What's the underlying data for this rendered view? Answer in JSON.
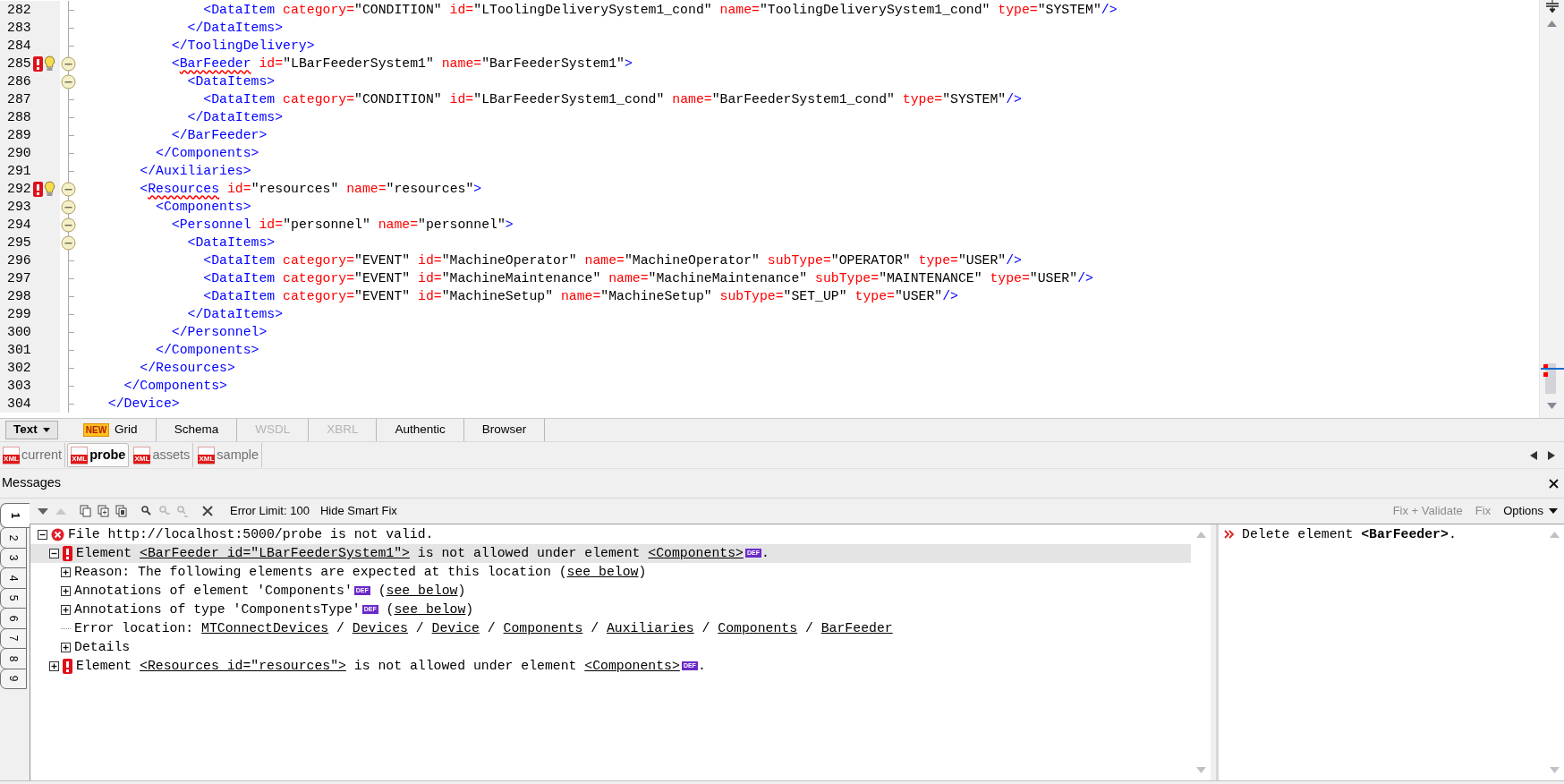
{
  "editor": {
    "lines": [
      {
        "number": "282",
        "error": false,
        "foldable": false,
        "tokens": [
          {
            "kind": "tag",
            "text": "              <DataItem"
          },
          {
            "kind": "attr",
            "text": " category="
          },
          {
            "kind": "value",
            "text": "\"CONDITION\""
          },
          {
            "kind": "attr",
            "text": " id="
          },
          {
            "kind": "value",
            "text": "\"LToolingDeliverySystem1_cond\""
          },
          {
            "kind": "attr",
            "text": " name="
          },
          {
            "kind": "value",
            "text": "\"ToolingDeliverySystem1_cond\""
          },
          {
            "kind": "attr",
            "text": " type="
          },
          {
            "kind": "value",
            "text": "\"SYSTEM\""
          },
          {
            "kind": "tag",
            "text": "/>"
          }
        ]
      },
      {
        "number": "283",
        "error": false,
        "foldable": false,
        "tokens": [
          {
            "kind": "tag",
            "text": "            </DataItems>"
          }
        ]
      },
      {
        "number": "284",
        "error": false,
        "foldable": false,
        "tokens": [
          {
            "kind": "tag",
            "text": "          </ToolingDelivery>"
          }
        ]
      },
      {
        "number": "285",
        "error": true,
        "foldable": true,
        "tokens": [
          {
            "kind": "tag",
            "text": "          <"
          },
          {
            "kind": "tag-error",
            "text": "BarFeeder"
          },
          {
            "kind": "attr",
            "text": " id="
          },
          {
            "kind": "value",
            "text": "\"LBarFeederSystem1\""
          },
          {
            "kind": "attr",
            "text": " name="
          },
          {
            "kind": "value",
            "text": "\"BarFeederSystem1\""
          },
          {
            "kind": "tag",
            "text": ">"
          }
        ]
      },
      {
        "number": "286",
        "error": false,
        "foldable": true,
        "tokens": [
          {
            "kind": "tag",
            "text": "            <DataItems>"
          }
        ]
      },
      {
        "number": "287",
        "error": false,
        "foldable": false,
        "tokens": [
          {
            "kind": "tag",
            "text": "              <DataItem"
          },
          {
            "kind": "attr",
            "text": " category="
          },
          {
            "kind": "value",
            "text": "\"CONDITION\""
          },
          {
            "kind": "attr",
            "text": " id="
          },
          {
            "kind": "value",
            "text": "\"LBarFeederSystem1_cond\""
          },
          {
            "kind": "attr",
            "text": " name="
          },
          {
            "kind": "value",
            "text": "\"BarFeederSystem1_cond\""
          },
          {
            "kind": "attr",
            "text": " type="
          },
          {
            "kind": "value",
            "text": "\"SYSTEM\""
          },
          {
            "kind": "tag",
            "text": "/>"
          }
        ]
      },
      {
        "number": "288",
        "error": false,
        "foldable": false,
        "tokens": [
          {
            "kind": "tag",
            "text": "            </DataItems>"
          }
        ]
      },
      {
        "number": "289",
        "error": false,
        "foldable": false,
        "tokens": [
          {
            "kind": "tag",
            "text": "          </BarFeeder>"
          }
        ]
      },
      {
        "number": "290",
        "error": false,
        "foldable": false,
        "tokens": [
          {
            "kind": "tag",
            "text": "        </Components>"
          }
        ]
      },
      {
        "number": "291",
        "error": false,
        "foldable": false,
        "tokens": [
          {
            "kind": "tag",
            "text": "      </Auxiliaries>"
          }
        ]
      },
      {
        "number": "292",
        "error": true,
        "foldable": true,
        "tokens": [
          {
            "kind": "tag",
            "text": "      <"
          },
          {
            "kind": "tag-error",
            "text": "Resources"
          },
          {
            "kind": "attr",
            "text": " id="
          },
          {
            "kind": "value",
            "text": "\"resources\""
          },
          {
            "kind": "attr",
            "text": " name="
          },
          {
            "kind": "value",
            "text": "\"resources\""
          },
          {
            "kind": "tag",
            "text": ">"
          }
        ]
      },
      {
        "number": "293",
        "error": false,
        "foldable": true,
        "tokens": [
          {
            "kind": "tag",
            "text": "        <Components>"
          }
        ]
      },
      {
        "number": "294",
        "error": false,
        "foldable": true,
        "tokens": [
          {
            "kind": "tag",
            "text": "          <Personnel"
          },
          {
            "kind": "attr",
            "text": " id="
          },
          {
            "kind": "value",
            "text": "\"personnel\""
          },
          {
            "kind": "attr",
            "text": " name="
          },
          {
            "kind": "value",
            "text": "\"personnel\""
          },
          {
            "kind": "tag",
            "text": ">"
          }
        ]
      },
      {
        "number": "295",
        "error": false,
        "foldable": true,
        "tokens": [
          {
            "kind": "tag",
            "text": "            <DataItems>"
          }
        ]
      },
      {
        "number": "296",
        "error": false,
        "foldable": false,
        "tokens": [
          {
            "kind": "tag",
            "text": "              <DataItem"
          },
          {
            "kind": "attr",
            "text": " category="
          },
          {
            "kind": "value",
            "text": "\"EVENT\""
          },
          {
            "kind": "attr",
            "text": " id="
          },
          {
            "kind": "value",
            "text": "\"MachineOperator\""
          },
          {
            "kind": "attr",
            "text": " name="
          },
          {
            "kind": "value",
            "text": "\"MachineOperator\""
          },
          {
            "kind": "attr",
            "text": " subType="
          },
          {
            "kind": "value",
            "text": "\"OPERATOR\""
          },
          {
            "kind": "attr",
            "text": " type="
          },
          {
            "kind": "value",
            "text": "\"USER\""
          },
          {
            "kind": "tag",
            "text": "/>"
          }
        ]
      },
      {
        "number": "297",
        "error": false,
        "foldable": false,
        "tokens": [
          {
            "kind": "tag",
            "text": "              <DataItem"
          },
          {
            "kind": "attr",
            "text": " category="
          },
          {
            "kind": "value",
            "text": "\"EVENT\""
          },
          {
            "kind": "attr",
            "text": " id="
          },
          {
            "kind": "value",
            "text": "\"MachineMaintenance\""
          },
          {
            "kind": "attr",
            "text": " name="
          },
          {
            "kind": "value",
            "text": "\"MachineMaintenance\""
          },
          {
            "kind": "attr",
            "text": " subType="
          },
          {
            "kind": "value",
            "text": "\"MAINTENANCE\""
          },
          {
            "kind": "attr",
            "text": " type="
          },
          {
            "kind": "value",
            "text": "\"USER\""
          },
          {
            "kind": "tag",
            "text": "/>"
          }
        ]
      },
      {
        "number": "298",
        "error": false,
        "foldable": false,
        "tokens": [
          {
            "kind": "tag",
            "text": "              <DataItem"
          },
          {
            "kind": "attr",
            "text": " category="
          },
          {
            "kind": "value",
            "text": "\"EVENT\""
          },
          {
            "kind": "attr",
            "text": " id="
          },
          {
            "kind": "value",
            "text": "\"MachineSetup\""
          },
          {
            "kind": "attr",
            "text": " name="
          },
          {
            "kind": "value",
            "text": "\"MachineSetup\""
          },
          {
            "kind": "attr",
            "text": " subType="
          },
          {
            "kind": "value",
            "text": "\"SET_UP\""
          },
          {
            "kind": "attr",
            "text": " type="
          },
          {
            "kind": "value",
            "text": "\"USER\""
          },
          {
            "kind": "tag",
            "text": "/>"
          }
        ]
      },
      {
        "number": "299",
        "error": false,
        "foldable": false,
        "tokens": [
          {
            "kind": "tag",
            "text": "            </DataItems>"
          }
        ]
      },
      {
        "number": "300",
        "error": false,
        "foldable": false,
        "tokens": [
          {
            "kind": "tag",
            "text": "          </Personnel>"
          }
        ]
      },
      {
        "number": "301",
        "error": false,
        "foldable": false,
        "tokens": [
          {
            "kind": "tag",
            "text": "        </Components>"
          }
        ]
      },
      {
        "number": "302",
        "error": false,
        "foldable": false,
        "tokens": [
          {
            "kind": "tag",
            "text": "      </Resources>"
          }
        ]
      },
      {
        "number": "303",
        "error": false,
        "foldable": false,
        "tokens": [
          {
            "kind": "tag",
            "text": "    </Components>"
          }
        ]
      },
      {
        "number": "304",
        "error": false,
        "foldable": false,
        "tokens": [
          {
            "kind": "tag",
            "text": "  </Device>"
          }
        ]
      }
    ]
  },
  "view_tabs": [
    {
      "label": "Text",
      "selected": true,
      "disabled": false,
      "dropdown": true
    },
    {
      "label": "Grid",
      "badge": "NEW",
      "selected": false,
      "disabled": false,
      "dropdown": false
    },
    {
      "label": "Schema",
      "selected": false,
      "disabled": false,
      "dropdown": false
    },
    {
      "label": "WSDL",
      "selected": false,
      "disabled": true,
      "dropdown": false
    },
    {
      "label": "XBRL",
      "selected": false,
      "disabled": true,
      "dropdown": false
    },
    {
      "label": "Authentic",
      "selected": false,
      "disabled": false,
      "dropdown": false
    },
    {
      "label": "Browser",
      "selected": false,
      "disabled": false,
      "dropdown": false
    }
  ],
  "file_tabs": [
    {
      "label": "current",
      "icon": "XML",
      "selected": false
    },
    {
      "label": "probe",
      "icon": "XML",
      "selected": true
    },
    {
      "label": "assets",
      "icon": "XML",
      "selected": false
    },
    {
      "label": "sample",
      "icon": "XML",
      "selected": false
    }
  ],
  "messages": {
    "title": "Messages",
    "tabs": [
      {
        "label": "1",
        "selected": true
      },
      {
        "label": "2",
        "selected": false
      },
      {
        "label": "3",
        "selected": false
      },
      {
        "label": "4",
        "selected": false
      },
      {
        "label": "5",
        "selected": false
      },
      {
        "label": "6",
        "selected": false
      },
      {
        "label": "7",
        "selected": false
      },
      {
        "label": "8",
        "selected": false
      },
      {
        "label": "9",
        "selected": false
      }
    ],
    "toolbar_icons": [
      {
        "kind": "next",
        "disabled": false
      },
      {
        "kind": "previous",
        "disabled": true
      },
      {
        "kind": "copy",
        "disabled": false
      },
      {
        "kind": "copy-add",
        "disabled": false
      },
      {
        "kind": "copy-all",
        "disabled": false
      },
      {
        "kind": "find",
        "disabled": false
      },
      {
        "kind": "find-next",
        "disabled": true
      },
      {
        "kind": "find-previous",
        "disabled": true
      },
      {
        "kind": "clear",
        "disabled": false
      }
    ],
    "toolbar_buttons": [
      {
        "label": "Error Limit: 100"
      },
      {
        "label": "Hide Smart Fix"
      }
    ],
    "smart_fix_buttons": [
      {
        "label": "Fix + Validate",
        "disabled": true,
        "dropdown": false
      },
      {
        "label": "Fix",
        "disabled": true,
        "dropdown": false
      },
      {
        "label": "Options",
        "disabled": false,
        "dropdown": true
      }
    ],
    "tree": [
      {
        "kind": "file-error",
        "expanded": true,
        "selected": false,
        "segments": [
          {
            "kind": "plain",
            "text": "File http://localhost:5000/probe is not valid."
          }
        ],
        "children": [
          {
            "kind": "error",
            "expanded": true,
            "selected": true,
            "segments": [
              {
                "kind": "plain",
                "text": "Element "
              },
              {
                "kind": "link",
                "text": "<BarFeeder id=\"LBarFeederSystem1\">"
              },
              {
                "kind": "plain",
                "text": " is not allowed under element "
              },
              {
                "kind": "link",
                "text": "<Components>"
              },
              {
                "kind": "def",
                "text": "DEF"
              },
              {
                "kind": "plain",
                "text": "."
              }
            ],
            "children": [
              {
                "expanded": false,
                "selected": false,
                "segments": [
                  {
                    "kind": "plain",
                    "text": "Reason: The following elements are expected at this location ("
                  },
                  {
                    "kind": "link",
                    "text": "see below"
                  },
                  {
                    "kind": "plain",
                    "text": ")"
                  }
                ]
              },
              {
                "expanded": false,
                "selected": false,
                "segments": [
                  {
                    "kind": "plain",
                    "text": "Annotations of element 'Components'"
                  },
                  {
                    "kind": "def",
                    "text": "DEF"
                  },
                  {
                    "kind": "plain",
                    "text": " ("
                  },
                  {
                    "kind": "link",
                    "text": "see below"
                  },
                  {
                    "kind": "plain",
                    "text": ")"
                  }
                ]
              },
              {
                "expanded": false,
                "selected": false,
                "segments": [
                  {
                    "kind": "plain",
                    "text": "Annotations of type 'ComponentsType'"
                  },
                  {
                    "kind": "def",
                    "text": "DEF"
                  },
                  {
                    "kind": "plain",
                    "text": " ("
                  },
                  {
                    "kind": "link",
                    "text": "see below"
                  },
                  {
                    "kind": "plain",
                    "text": ")"
                  }
                ]
              },
              {
                "selected": false,
                "segments": [
                  {
                    "kind": "plain",
                    "text": "Error location: "
                  },
                  {
                    "kind": "link",
                    "text": "MTConnectDevices"
                  },
                  {
                    "kind": "plain",
                    "text": " / "
                  },
                  {
                    "kind": "link",
                    "text": "Devices"
                  },
                  {
                    "kind": "plain",
                    "text": " / "
                  },
                  {
                    "kind": "link",
                    "text": "Device"
                  },
                  {
                    "kind": "plain",
                    "text": " / "
                  },
                  {
                    "kind": "link",
                    "text": "Components"
                  },
                  {
                    "kind": "plain",
                    "text": " / "
                  },
                  {
                    "kind": "link",
                    "text": "Auxiliaries"
                  },
                  {
                    "kind": "plain",
                    "text": " / "
                  },
                  {
                    "kind": "link",
                    "text": "Components"
                  },
                  {
                    "kind": "plain",
                    "text": " / "
                  },
                  {
                    "kind": "link",
                    "text": "BarFeeder"
                  }
                ]
              },
              {
                "expanded": false,
                "selected": false,
                "segments": [
                  {
                    "kind": "plain",
                    "text": "Details"
                  }
                ]
              }
            ]
          },
          {
            "kind": "error",
            "expanded": false,
            "selected": false,
            "segments": [
              {
                "kind": "plain",
                "text": "Element "
              },
              {
                "kind": "link",
                "text": "<Resources id=\"resources\">"
              },
              {
                "kind": "plain",
                "text": " is not allowed under element "
              },
              {
                "kind": "link",
                "text": "<Components>"
              },
              {
                "kind": "def",
                "text": "DEF"
              },
              {
                "kind": "plain",
                "text": "."
              }
            ]
          }
        ]
      }
    ],
    "smart_fix": [
      {
        "text": "Delete element **<BarFeeder>**."
      }
    ]
  }
}
